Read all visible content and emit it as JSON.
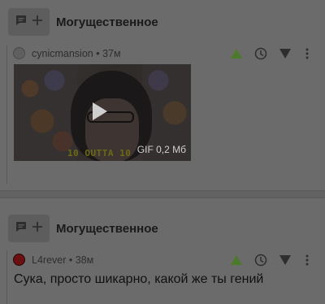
{
  "comments": [
    {
      "award_title": "Могущественное",
      "username": "cynicmansion",
      "time": "37м",
      "media": {
        "caption": "10 OUTTA 10",
        "gif_label": "GIF 0,2 Мб"
      }
    },
    {
      "award_title": "Могущественное",
      "username": "L4rever",
      "time": "38м",
      "text": "Сука, просто шикарно, какой же ты гений"
    }
  ],
  "meta_separator": " • ",
  "colors": {
    "upvote": "#4a7a2a",
    "icon": "#2e2e2e",
    "background": "#6b6b6b"
  },
  "icons": [
    "comment-icon",
    "plus-icon",
    "upvote-icon",
    "clock-icon",
    "downvote-icon",
    "more-icon",
    "play-icon"
  ]
}
